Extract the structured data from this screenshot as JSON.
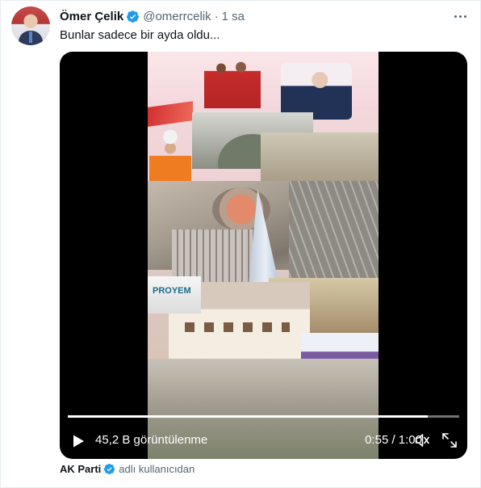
{
  "tweet": {
    "author_name": "Ömer Çelik",
    "handle": "@omerrcelik",
    "separator": "·",
    "time": "1 sa",
    "text": "Bunlar sadece bir ayda oldu...",
    "verified_color": "#1d9bf0"
  },
  "video": {
    "views": "45,2 B görüntülenme",
    "timecode": "0:55 / 1:00",
    "progress": 0.92,
    "overlay_text": "PROYEM"
  },
  "attribution": {
    "name": "AK Parti",
    "text": "adlı kullanıcıdan"
  },
  "icons": {
    "more": "more-icon",
    "play": "play-icon",
    "volume": "volume-icon",
    "fullscreen": "fullscreen-icon",
    "verified": "verified-badge-icon"
  }
}
